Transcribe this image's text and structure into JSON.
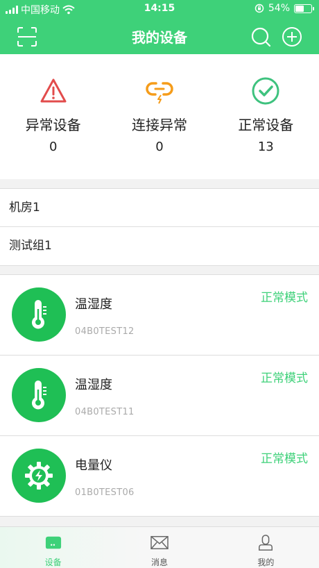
{
  "status_bar": {
    "carrier": "中国移动",
    "time": "14:15",
    "battery_percent": "54%",
    "battery_level": 0.54
  },
  "header": {
    "title": "我的设备",
    "icons": [
      "scan-icon",
      "search-icon",
      "add-icon"
    ]
  },
  "stats": [
    {
      "label": "异常设备",
      "value": "0",
      "icon": "warning-triangle-icon",
      "color": "#e24c4c"
    },
    {
      "label": "连接异常",
      "value": "0",
      "icon": "broken-link-icon",
      "color": "#f59c1a"
    },
    {
      "label": "正常设备",
      "value": "13",
      "icon": "check-circle-icon",
      "color": "#3ec27e"
    }
  ],
  "groups": [
    {
      "label": "机房1"
    },
    {
      "label": "测试组1"
    }
  ],
  "devices": [
    {
      "name": "温湿度",
      "id": "04B0TEST12",
      "mode": "正常模式",
      "icon": "thermometer-icon"
    },
    {
      "name": "温湿度",
      "id": "04B0TEST11",
      "mode": "正常模式",
      "icon": "thermometer-icon"
    },
    {
      "name": "电量仪",
      "id": "01B0TEST06",
      "mode": "正常模式",
      "icon": "power-gear-icon"
    }
  ],
  "tabbar": [
    {
      "label": "设备",
      "icon": "device-icon",
      "active": true
    },
    {
      "label": "消息",
      "icon": "mail-icon",
      "active": false
    },
    {
      "label": "我的",
      "icon": "person-icon",
      "active": false
    }
  ],
  "colors": {
    "brand": "#3ed179",
    "device_icon_bg": "#1fbf55"
  }
}
